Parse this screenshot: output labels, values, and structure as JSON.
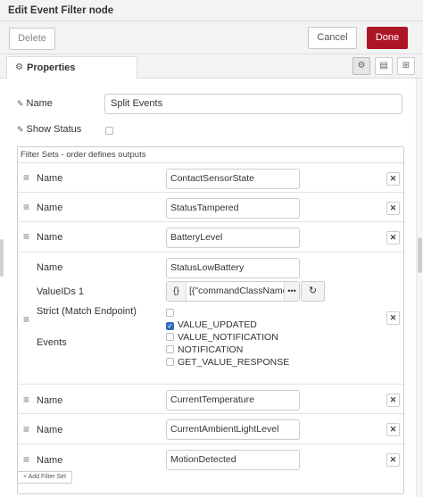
{
  "window": {
    "title": "Edit Event Filter node"
  },
  "toolbar": {
    "delete_label": "Delete",
    "cancel_label": "Cancel",
    "done_label": "Done"
  },
  "tabs": {
    "properties_label": "Properties"
  },
  "colors": {
    "done": "#ad1625",
    "checked": "#2d6cc0"
  },
  "properties": {
    "name_label": "Name",
    "name_value": "Split Events",
    "show_status_label": "Show Status",
    "show_status_checked": false
  },
  "filter_sets": {
    "header": "Filter Sets - order defines outputs",
    "name_label": "Name",
    "valueids_label": "ValueIDs 1",
    "strict_label": "Strict (Match Endpoint)",
    "events_label": "Events",
    "items": [
      {
        "name": "ContactSensorState"
      },
      {
        "name": "StatusTampered"
      },
      {
        "name": "BatteryLevel"
      },
      {
        "name": "StatusLowBattery",
        "valueids": "[{\"commandClassName",
        "strict_checked": false,
        "events": [
          {
            "label": "VALUE_UPDATED",
            "checked": true
          },
          {
            "label": "VALUE_NOTIFICATION",
            "checked": false
          },
          {
            "label": "NOTIFICATION",
            "checked": false
          },
          {
            "label": "GET_VALUE_RESPONSE",
            "checked": false
          }
        ]
      },
      {
        "name": "CurrentTemperature"
      },
      {
        "name": "CurrentAmbientLightLevel"
      },
      {
        "name": "MotionDetected"
      }
    ],
    "add_label": "Add Filter Set"
  }
}
